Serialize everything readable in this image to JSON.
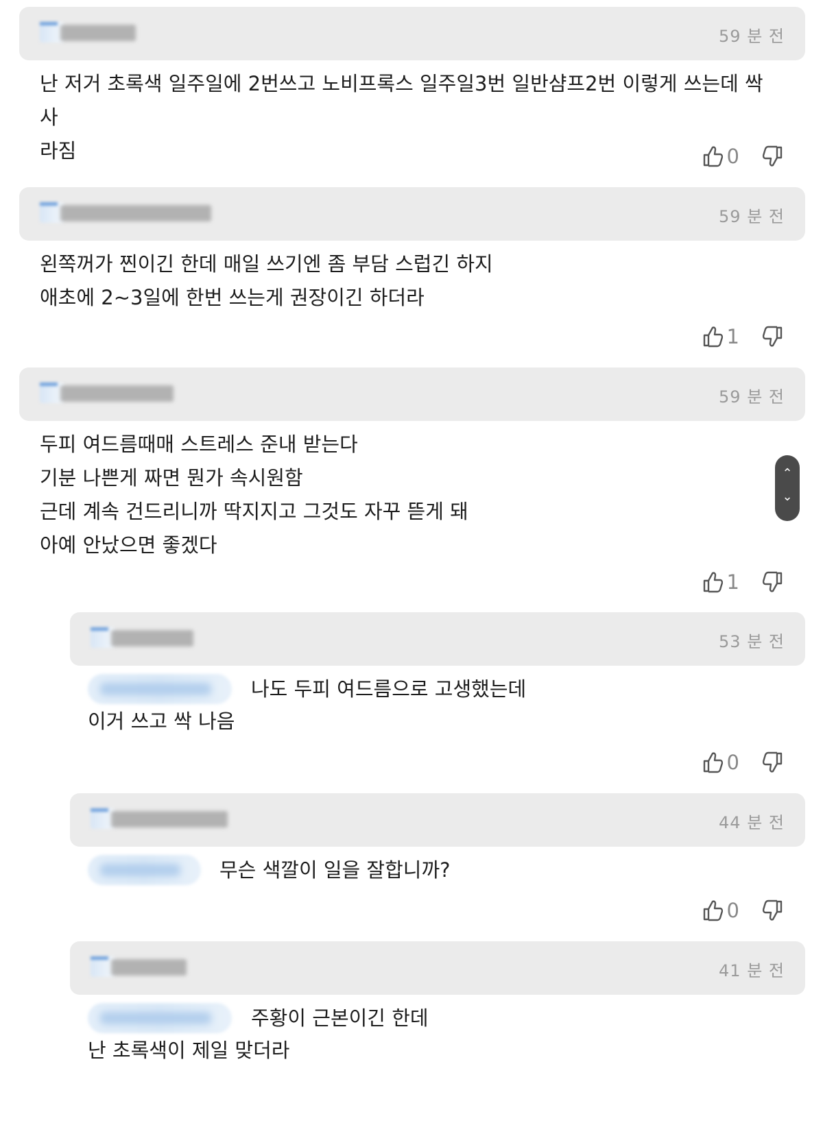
{
  "comments": [
    {
      "time": "59 분 전",
      "lines": "난 저거 초록색 일주일에 2번쓰고 노비프록스 일주일3번 일반샴프2번 이렇게 쓰는데 싹 사\n라짐",
      "likes": "0"
    },
    {
      "time": "59 분 전",
      "lines": "왼쪽꺼가 찐이긴 한데 매일 쓰기엔 좀 부담 스럽긴 하지\n애초에 2~3일에 한번 쓰는게 권장이긴 하더라",
      "likes": "1"
    },
    {
      "time": "59 분 전",
      "lines": "두피 여드름때매 스트레스 준내 받는다\n기분 나쁜게 짜면 뭔가 속시원함\n근데 계속 건드리니까 딱지지고 그것도 자꾸 뜯게 돼\n아예 안났으면 좋겠다",
      "likes": "1"
    }
  ],
  "replies": [
    {
      "time": "53 분 전",
      "first_line": "나도 두피 여드름으로 고생했는데",
      "rest": "이거 쓰고 싹 나음",
      "likes": "0"
    },
    {
      "time": "44 분 전",
      "first_line": "무슨 색깔이 일을 잘합니까?",
      "rest": "",
      "likes": "0"
    },
    {
      "time": "41 분 전",
      "first_line": "주황이 근본이긴 한데",
      "rest": "난 초록색이 제일 맞더라",
      "likes": ""
    }
  ],
  "icons": {
    "like": "thumbs-up-icon",
    "dislike": "thumbs-down-icon",
    "scroll_up": "chevron-up-icon",
    "scroll_down": "chevron-down-icon"
  }
}
